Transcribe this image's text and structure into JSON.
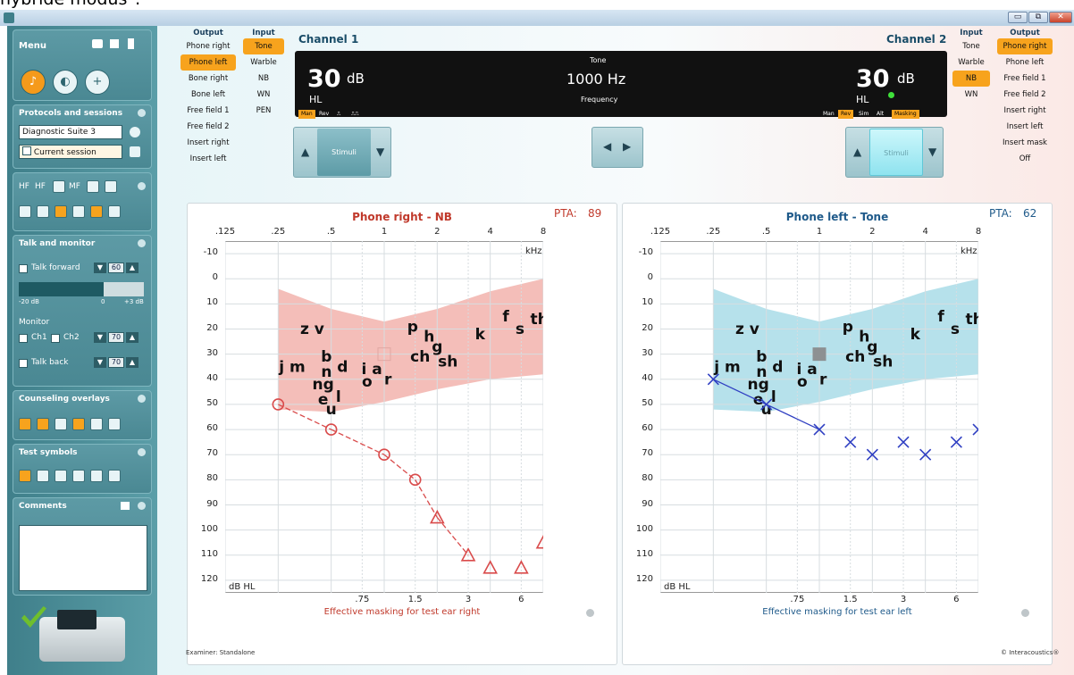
{
  "caption": "hybride modus\".",
  "window": {
    "min_label": "▭",
    "restore_label": "⧉",
    "close_label": "✕"
  },
  "sidebar": {
    "menu_label": "Menu",
    "protocols": {
      "title": "Protocols and sessions",
      "protocol": "Diagnostic Suite 3",
      "session": "Current session"
    },
    "hf_row": [
      "HF",
      "HF",
      "MF"
    ],
    "talk": {
      "title": "Talk and monitor",
      "talk_forward": "Talk forward",
      "talk_forward_value": "60",
      "scale_left": "-20 dB",
      "scale_mid": "0",
      "scale_right": "+3 dB",
      "monitor": "Monitor",
      "ch1": "Ch1",
      "ch2": "Ch2",
      "monitor_value": "70",
      "talk_back": "Talk back",
      "talk_back_value": "70"
    },
    "counseling": {
      "title": "Counseling overlays"
    },
    "test_symbols": {
      "title": "Test symbols"
    },
    "comments": {
      "title": "Comments"
    }
  },
  "ch1": {
    "output": {
      "header": "Output",
      "options": [
        "Phone right",
        "Phone left",
        "Bone right",
        "Bone left",
        "Free field 1",
        "Free field 2",
        "Insert right",
        "Insert left"
      ],
      "selected": 1
    },
    "input": {
      "header": "Input",
      "options": [
        "Tone",
        "Warble",
        "NB",
        "WN",
        "PEN"
      ],
      "selected": 0
    },
    "label": "Channel 1",
    "level": "30",
    "unit": "dB",
    "hl": "HL",
    "states": [
      "Man",
      "Rev",
      "⎍",
      "⎍⎍"
    ],
    "stimuli": "Stimuli"
  },
  "center": {
    "tone_label": "Tone",
    "frequency": "1000 Hz",
    "frequency_label": "Frequency"
  },
  "ch2": {
    "label": "Channel 2",
    "level": "30",
    "unit": "dB",
    "hl": "HL",
    "states": [
      "Man",
      "Rev",
      "Sim",
      "Alt",
      "Masking"
    ],
    "stimuli": "Stimuli",
    "input": {
      "header": "Input",
      "options": [
        "Tone",
        "Warble",
        "NB",
        "WN"
      ],
      "selected": 2
    },
    "output": {
      "header": "Output",
      "options": [
        "Phone right",
        "Phone left",
        "Free field 1",
        "Free field 2",
        "Insert right",
        "Insert left",
        "Insert mask",
        "Off"
      ],
      "selected": 0
    }
  },
  "charts": [
    {
      "title": "Phone right - NB",
      "pta_label": "PTA:",
      "pta_value": "89",
      "color": "#d94b4b",
      "band_color": "#f2b3ad",
      "freq_labels": [
        ".125",
        ".25",
        ".5",
        "1",
        "2",
        "4",
        "8"
      ],
      "khz": "kHz",
      "y_ticks": [
        "-10",
        "0",
        "10",
        "20",
        "30",
        "40",
        "50",
        "60",
        "70",
        "80",
        "90",
        "100",
        "110",
        "120"
      ],
      "dbhl": "dB HL",
      "masking_labels": [
        ".75",
        "1.5",
        "3",
        "6"
      ],
      "masking_title": "Effective masking for test ear right",
      "marker": "circle",
      "points": [
        {
          "f": 0.25,
          "db": 50,
          "m": "o"
        },
        {
          "f": 0.5,
          "db": 60,
          "m": "o"
        },
        {
          "f": 1,
          "db": 70,
          "m": "o"
        },
        {
          "f": 1.5,
          "db": 80,
          "m": "o"
        },
        {
          "f": 2,
          "db": 95,
          "m": "t"
        },
        {
          "f": 3,
          "db": 110,
          "m": "t"
        },
        {
          "f": 4,
          "db": 115,
          "m": "t"
        },
        {
          "f": 6,
          "db": 115,
          "m": "t"
        },
        {
          "f": 8,
          "db": 105,
          "m": "t"
        }
      ],
      "lines": [
        [
          0.25,
          0.5
        ],
        [
          0.5,
          1
        ],
        [
          1,
          1.5
        ],
        [
          1.5,
          2
        ],
        [
          2,
          3
        ]
      ]
    },
    {
      "title": "Phone left - Tone",
      "pta_label": "PTA:",
      "pta_value": "62",
      "color": "#2f3fc2",
      "band_color": "#a9dce8",
      "freq_labels": [
        ".125",
        ".25",
        ".5",
        "1",
        "2",
        "4",
        "8"
      ],
      "khz": "kHz",
      "y_ticks": [
        "-10",
        "0",
        "10",
        "20",
        "30",
        "40",
        "50",
        "60",
        "70",
        "80",
        "90",
        "100",
        "110",
        "120"
      ],
      "dbhl": "dB HL",
      "masking_labels": [
        ".75",
        "1.5",
        "3",
        "6"
      ],
      "masking_title": "Effective masking for test ear left",
      "marker": "x",
      "points": [
        {
          "f": 0.25,
          "db": 40,
          "m": "x"
        },
        {
          "f": 0.5,
          "db": 50,
          "m": "x"
        },
        {
          "f": 1,
          "db": 60,
          "m": "x"
        },
        {
          "f": 1.5,
          "db": 65,
          "m": "x"
        },
        {
          "f": 2,
          "db": 70,
          "m": "x"
        },
        {
          "f": 3,
          "db": 65,
          "m": "x"
        },
        {
          "f": 4,
          "db": 70,
          "m": "x"
        },
        {
          "f": 6,
          "db": 65,
          "m": "x"
        },
        {
          "f": 8,
          "db": 60,
          "m": "x"
        }
      ],
      "lines": [
        [
          0.25,
          0.5
        ],
        [
          0.5,
          1
        ]
      ]
    }
  ],
  "speech_letters": [
    {
      "t": "z v",
      "f": 0.39,
      "db": 22
    },
    {
      "t": "p",
      "f": 1.45,
      "db": 21
    },
    {
      "t": "h",
      "f": 1.8,
      "db": 25
    },
    {
      "t": "g",
      "f": 2.0,
      "db": 29
    },
    {
      "t": "ch",
      "f": 1.6,
      "db": 33
    },
    {
      "t": "sh",
      "f": 2.3,
      "db": 35
    },
    {
      "t": "k",
      "f": 3.5,
      "db": 24
    },
    {
      "t": "f",
      "f": 4.9,
      "db": 17
    },
    {
      "t": "s",
      "f": 5.9,
      "db": 22
    },
    {
      "t": "th",
      "f": 7.6,
      "db": 18
    },
    {
      "t": "b",
      "f": 0.47,
      "db": 33
    },
    {
      "t": "j m",
      "f": 0.3,
      "db": 37
    },
    {
      "t": "d",
      "f": 0.58,
      "db": 37
    },
    {
      "t": "n",
      "f": 0.47,
      "db": 39
    },
    {
      "t": "i a",
      "f": 0.85,
      "db": 38
    },
    {
      "t": "o",
      "f": 0.8,
      "db": 43
    },
    {
      "t": "r",
      "f": 1.05,
      "db": 42
    },
    {
      "t": "ng",
      "f": 0.45,
      "db": 44
    },
    {
      "t": "e",
      "f": 0.45,
      "db": 50
    },
    {
      "t": "l",
      "f": 0.55,
      "db": 49
    },
    {
      "t": "u",
      "f": 0.5,
      "db": 54
    }
  ],
  "footer": {
    "examiner": "Examiner: Standalone",
    "brand": "© Interacoustics®"
  }
}
